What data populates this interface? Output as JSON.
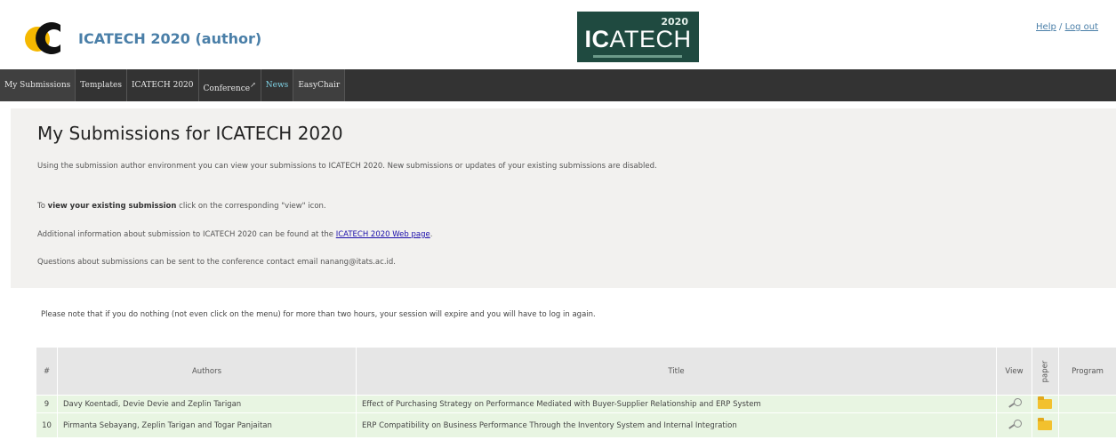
{
  "header": {
    "app_title": "ICATECH 2020 (author)",
    "logo_brand_a": "IC",
    "logo_brand_b": "ATECH",
    "logo_year": "2020",
    "help_link": "Help",
    "separator": "/",
    "logout_link": "Log out"
  },
  "menu": [
    {
      "label": "My Submissions"
    },
    {
      "label": "Templates"
    },
    {
      "label": "ICATECH 2020"
    },
    {
      "label": "Conference"
    },
    {
      "label": "News"
    },
    {
      "label": "EasyChair"
    }
  ],
  "info": {
    "title": "My Submissions for ICATECH 2020",
    "para1": "Using the submission author environment you can view your submissions to ICATECH 2020. New submissions or updates of your existing submissions are disabled.",
    "para2_pre": "To ",
    "para2_bold": "view your existing submission",
    "para2_post": " click on the corresponding \"view\" icon.",
    "para3_pre": "Additional information about submission to ICATECH 2020 can be found at the ",
    "para3_link": "ICATECH 2020 Web page",
    "para3_post": ".",
    "para4": "Questions about submissions can be sent to the conference contact email nanang@itats.ac.id."
  },
  "warning": "Please note that if you do nothing (not even click on the menu) for more than two hours, your session will expire and you will have to log in again.",
  "table": {
    "headers": {
      "num": "#",
      "authors": "Authors",
      "title": "Title",
      "view": "View",
      "paper": "paper",
      "program": "Program"
    },
    "rows": [
      {
        "num": "9",
        "authors": "Davy Koentadi, Devie Devie and Zeplin Tarigan",
        "title": "Effect of Purchasing Strategy on Performance Mediated with Buyer-Supplier Relationship and ERP System"
      },
      {
        "num": "10",
        "authors": "Pirmanta Sebayang, Zeplin Tarigan and Togar Panjaitan",
        "title": "ERP Compatibility on Business Performance Through the Inventory System and Internal Integration"
      }
    ]
  }
}
